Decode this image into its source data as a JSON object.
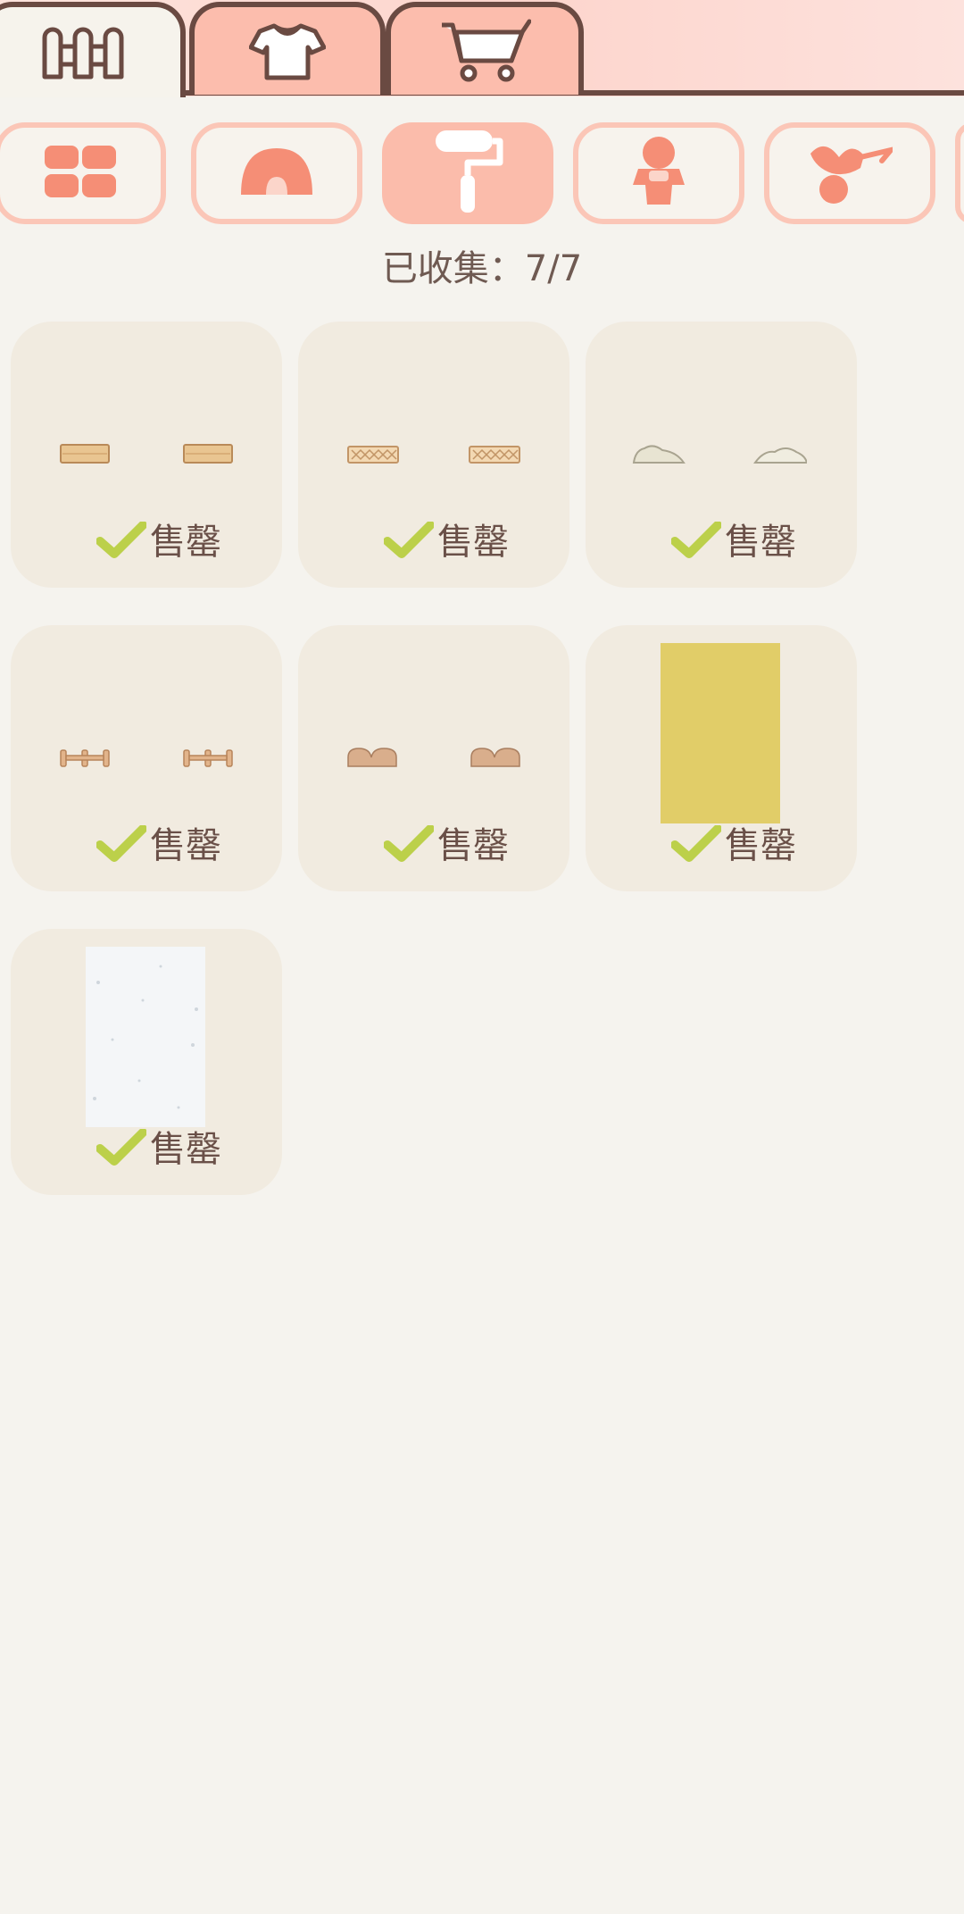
{
  "main_tabs": [
    {
      "icon": "fence-icon",
      "active": true
    },
    {
      "icon": "shirt-icon",
      "active": false
    },
    {
      "icon": "cart-icon",
      "active": false
    }
  ],
  "categories": [
    {
      "icon": "grid-icon",
      "active": false
    },
    {
      "icon": "dome-icon",
      "active": false
    },
    {
      "icon": "paint-roller-icon",
      "active": true
    },
    {
      "icon": "figure-icon",
      "active": false
    },
    {
      "icon": "fruit-icon",
      "active": false
    }
  ],
  "collected_text": "已收集：7/7",
  "items": [
    {
      "status": "售罄",
      "type": "wood-plank-fence"
    },
    {
      "status": "售罄",
      "type": "lattice-fence"
    },
    {
      "status": "售罄",
      "type": "stone-path"
    },
    {
      "status": "售罄",
      "type": "rail-fence"
    },
    {
      "status": "售罄",
      "type": "round-stone-fence"
    },
    {
      "status": "售罄",
      "type": "yellow-wallpaper"
    },
    {
      "status": "售罄",
      "type": "white-wallpaper"
    }
  ],
  "colors": {
    "accent": "#fbbcab",
    "check": "#bcd04a",
    "card": "#f1ebe0",
    "yellow_wallpaper": "#e1cd68",
    "white_wallpaper": "#f4f6f8"
  }
}
